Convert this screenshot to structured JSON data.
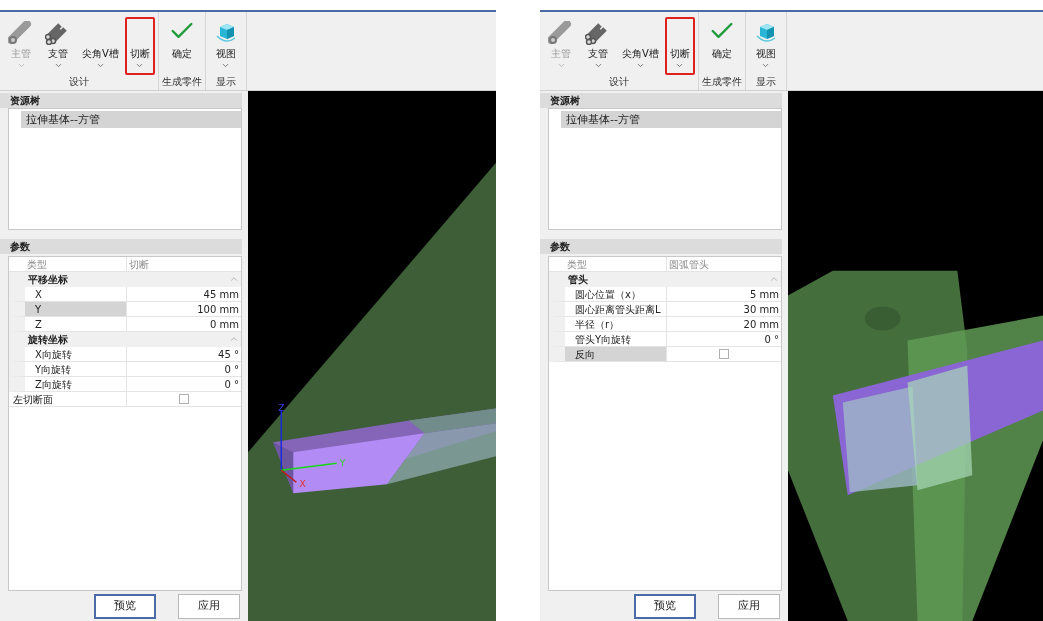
{
  "panels": [
    {
      "toolbar": {
        "groups": [
          {
            "label": "设计",
            "buttons": [
              {
                "label": "主管",
                "kind": "main-pipe",
                "caret": true,
                "disabled": true,
                "highlighted": false
              },
              {
                "label": "支管",
                "kind": "branch-pipe",
                "caret": true,
                "disabled": false,
                "highlighted": false
              },
              {
                "label": "尖角V槽",
                "kind": "text",
                "caret": true,
                "disabled": false,
                "highlighted": false
              },
              {
                "label": "切断",
                "kind": "text",
                "caret": true,
                "disabled": false,
                "highlighted": true
              }
            ]
          },
          {
            "label": "生成零件",
            "buttons": [
              {
                "label": "确定",
                "kind": "confirm",
                "caret": false,
                "disabled": false,
                "highlighted": false
              }
            ]
          },
          {
            "label": "显示",
            "buttons": [
              {
                "label": "视图",
                "kind": "view",
                "caret": true,
                "disabled": false,
                "highlighted": false
              }
            ]
          }
        ]
      },
      "tree": {
        "title": "资源树",
        "items": [
          {
            "label": "拉伸基体--方管",
            "selected": true
          }
        ]
      },
      "params": {
        "title": "参数",
        "rows": [
          {
            "kind": "type",
            "label": "类型",
            "value": "切断"
          },
          {
            "kind": "group",
            "label": "平移坐标",
            "expanded": true,
            "children": [
              {
                "kind": "field",
                "label": "X",
                "value": "45 mm",
                "selected": false
              },
              {
                "kind": "field",
                "label": "Y",
                "value": "100 mm",
                "selected": true
              },
              {
                "kind": "field",
                "label": "Z",
                "value": "0 mm",
                "selected": false
              }
            ]
          },
          {
            "kind": "group",
            "label": "旋转坐标",
            "expanded": true,
            "children": [
              {
                "kind": "field",
                "label": "X向旋转",
                "value": "45 °",
                "selected": false
              },
              {
                "kind": "field",
                "label": "Y向旋转",
                "value": "0 °",
                "selected": false
              },
              {
                "kind": "field",
                "label": "Z向旋转",
                "value": "0 °",
                "selected": false
              }
            ]
          },
          {
            "kind": "checkbox",
            "label": "左切断面",
            "checked": false,
            "selected": false
          }
        ]
      },
      "viewport": {
        "kind": "cut",
        "axis_labels": [
          "Z",
          "Y",
          "X"
        ]
      },
      "buttons": [
        {
          "label": "预览",
          "focused": true
        },
        {
          "label": "应用",
          "focused": false
        }
      ]
    },
    {
      "toolbar": {
        "groups": [
          {
            "label": "设计",
            "buttons": [
              {
                "label": "主管",
                "kind": "main-pipe",
                "caret": true,
                "disabled": true,
                "highlighted": false
              },
              {
                "label": "支管",
                "kind": "branch-pipe",
                "caret": true,
                "disabled": false,
                "highlighted": false
              },
              {
                "label": "尖角V槽",
                "kind": "text",
                "caret": true,
                "disabled": false,
                "highlighted": false
              },
              {
                "label": "切断",
                "kind": "text",
                "caret": true,
                "disabled": false,
                "highlighted": true
              }
            ]
          },
          {
            "label": "生成零件",
            "buttons": [
              {
                "label": "确定",
                "kind": "confirm",
                "caret": false,
                "disabled": false,
                "highlighted": false
              }
            ]
          },
          {
            "label": "显示",
            "buttons": [
              {
                "label": "视图",
                "kind": "view",
                "caret": true,
                "disabled": false,
                "highlighted": false
              }
            ]
          }
        ]
      },
      "tree": {
        "title": "资源树",
        "items": [
          {
            "label": "拉伸基体--方管",
            "selected": true
          }
        ]
      },
      "params": {
        "title": "参数",
        "rows": [
          {
            "kind": "type",
            "label": "类型",
            "value": "圆弧管头"
          },
          {
            "kind": "group",
            "label": "管头",
            "expanded": true,
            "children": [
              {
                "kind": "field",
                "label": "圆心位置（x）",
                "value": "5 mm",
                "selected": false
              },
              {
                "kind": "field",
                "label": "圆心距离管头距离L",
                "value": "30 mm",
                "selected": false
              },
              {
                "kind": "field",
                "label": "半径（r）",
                "value": "20 mm",
                "selected": false
              },
              {
                "kind": "field",
                "label": "管头Y向旋转",
                "value": "0 °",
                "selected": false
              },
              {
                "kind": "checkbox",
                "label": "反向",
                "checked": false,
                "selected": true
              }
            ]
          }
        ]
      },
      "viewport": {
        "kind": "arc-end"
      },
      "buttons": [
        {
          "label": "预览",
          "focused": true
        },
        {
          "label": "应用",
          "focused": false
        }
      ]
    }
  ]
}
